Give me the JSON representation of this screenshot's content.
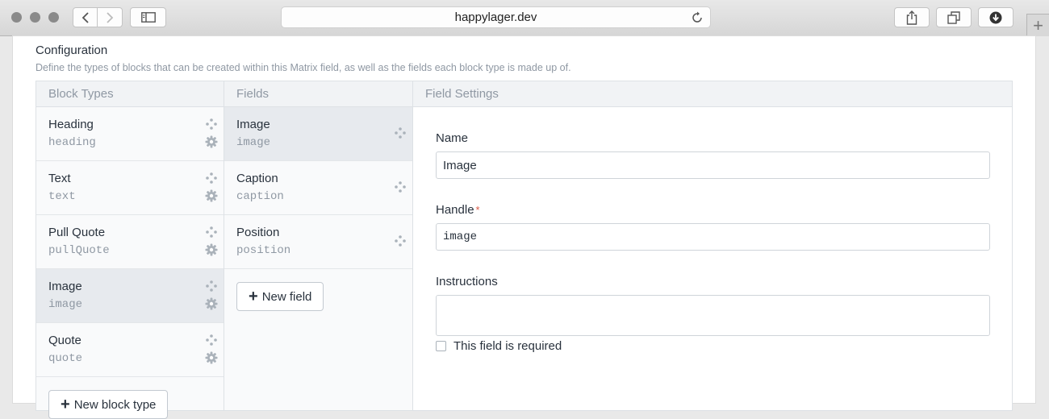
{
  "browser": {
    "url": "happylager.dev",
    "icons": {
      "back": "chevron-left-icon",
      "forward": "chevron-right-icon",
      "sidebar": "sidebar-icon",
      "reload": "reload-icon",
      "share": "share-icon",
      "tabs": "tabs-icon",
      "downloads": "download-icon",
      "new_tab": "+"
    }
  },
  "config": {
    "title": "Configuration",
    "description": "Define the types of blocks that can be created within this Matrix field, as well as the fields each block type is made up of."
  },
  "block_types": {
    "header": "Block Types",
    "items": [
      {
        "name": "Heading",
        "handle": "heading",
        "selected": false
      },
      {
        "name": "Text",
        "handle": "text",
        "selected": false
      },
      {
        "name": "Pull Quote",
        "handle": "pullQuote",
        "selected": false
      },
      {
        "name": "Image",
        "handle": "image",
        "selected": true
      },
      {
        "name": "Quote",
        "handle": "quote",
        "selected": false
      }
    ],
    "new_button": "New block type"
  },
  "fields": {
    "header": "Fields",
    "items": [
      {
        "name": "Image",
        "handle": "image",
        "selected": true
      },
      {
        "name": "Caption",
        "handle": "caption",
        "selected": false
      },
      {
        "name": "Position",
        "handle": "position",
        "selected": false
      }
    ],
    "new_button": "New field"
  },
  "field_settings": {
    "header": "Field Settings",
    "name_label": "Name",
    "name_value": "Image",
    "handle_label": "Handle",
    "required_mark": "*",
    "handle_value": "image",
    "instructions_label": "Instructions",
    "instructions_value": "",
    "required_label": "This field is required"
  },
  "colors": {
    "accent_required": "#da5a47",
    "selected_row": "#e7eaee",
    "muted_text": "#8f98a3"
  }
}
